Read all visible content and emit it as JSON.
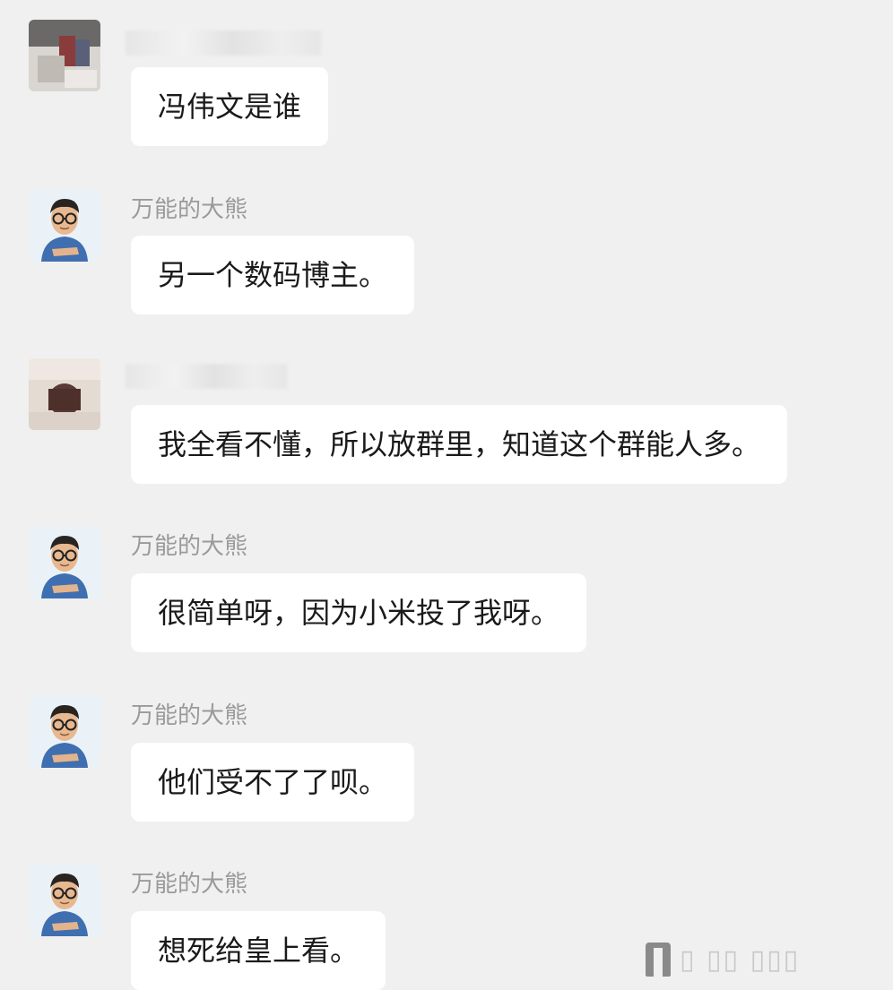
{
  "chat": {
    "messages": [
      {
        "sender": "",
        "sender_hidden": true,
        "avatar": "blurred-photo-avatar",
        "text": "冯伟文是谁"
      },
      {
        "sender": "万能的大熊",
        "sender_hidden": false,
        "avatar": "cartoon-man-glasses-avatar",
        "text": "另一个数码博主。"
      },
      {
        "sender": "",
        "sender_hidden": true,
        "avatar": "blurred-photo-avatar",
        "text": "我全看不懂，所以放群里，知道这个群能人多。"
      },
      {
        "sender": "万能的大熊",
        "sender_hidden": false,
        "avatar": "cartoon-man-glasses-avatar",
        "text": "很简单呀，因为小米投了我呀。"
      },
      {
        "sender": "万能的大熊",
        "sender_hidden": false,
        "avatar": "cartoon-man-glasses-avatar",
        "text": "他们受不了了呗。"
      },
      {
        "sender": "万能的大熊",
        "sender_hidden": false,
        "avatar": "cartoon-man-glasses-avatar",
        "text": "想死给皇上看。"
      }
    ]
  },
  "watermark": {
    "icon": "platform-logo-icon"
  },
  "colors": {
    "background": "#f0f0f0",
    "bubble": "#ffffff",
    "sender": "#9a9a9a",
    "text": "#1a1a1a"
  }
}
